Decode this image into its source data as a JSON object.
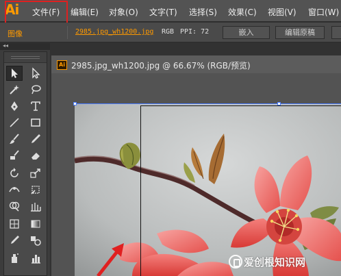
{
  "app": {
    "logo": "Ai",
    "logo_color": "#ff9a00"
  },
  "menubar": {
    "items": [
      {
        "label": "文件(F)"
      },
      {
        "label": "编辑(E)"
      },
      {
        "label": "对象(O)"
      },
      {
        "label": "文字(T)"
      },
      {
        "label": "选择(S)"
      },
      {
        "label": "效果(C)"
      },
      {
        "label": "视图(V)"
      },
      {
        "label": "窗口(W)"
      }
    ],
    "highlight_color": "#e02020"
  },
  "controlbar": {
    "object_type": "图像",
    "filename": "2985.jpg_wh1200.jpg",
    "colormode": "RGB",
    "ppi_label": "PPI: 72",
    "embed_button": "嵌入",
    "edit_original_button": "编辑原稿",
    "accent_color": "#ff9a00"
  },
  "document": {
    "title": "2985.jpg_wh1200.jpg @ 66.67% (RGB/预览)",
    "icon": "Ai"
  },
  "tools": [
    {
      "icon": "selection-tool-icon"
    },
    {
      "icon": "direct-selection-tool-icon"
    },
    {
      "icon": "magic-wand-tool-icon"
    },
    {
      "icon": "lasso-tool-icon"
    },
    {
      "icon": "pen-tool-icon"
    },
    {
      "icon": "type-tool-icon"
    },
    {
      "icon": "line-segment-tool-icon"
    },
    {
      "icon": "rectangle-tool-icon"
    },
    {
      "icon": "paintbrush-tool-icon"
    },
    {
      "icon": "pencil-tool-icon"
    },
    {
      "icon": "blob-brush-tool-icon"
    },
    {
      "icon": "eraser-tool-icon"
    },
    {
      "icon": "rotate-tool-icon"
    },
    {
      "icon": "scale-tool-icon"
    },
    {
      "icon": "width-tool-icon"
    },
    {
      "icon": "free-transform-tool-icon"
    },
    {
      "icon": "shape-builder-tool-icon"
    },
    {
      "icon": "perspective-grid-tool-icon"
    },
    {
      "icon": "mesh-tool-icon"
    },
    {
      "icon": "gradient-tool-icon"
    },
    {
      "icon": "eyedropper-tool-icon"
    },
    {
      "icon": "blend-tool-icon"
    },
    {
      "icon": "symbol-sprayer-tool-icon"
    },
    {
      "icon": "column-graph-tool-icon"
    }
  ],
  "watermark": {
    "text": "爱创根知识网"
  }
}
